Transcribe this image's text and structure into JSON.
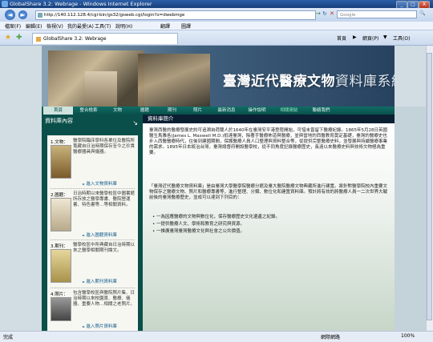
{
  "window": {
    "title": "GlobalShare 3.2: Webrage - Windows Internet Explorer",
    "minimize": "_",
    "maximize": "□",
    "close": "X"
  },
  "addressbar": {
    "url": "http://140.112.128.4/cgi-bin/gs32/gsweb.cgi/login?o=dwebmge",
    "search_placeholder": "Google",
    "back": "◄",
    "forward": "►",
    "go": "→",
    "refresh": "↻",
    "stop": "✕",
    "search_go": "🔍"
  },
  "menubar": {
    "items": [
      "檔案(F)",
      "編輯(E)",
      "檢視(V)",
      "我的最愛(A)",
      "工具(T)",
      "說明(H)"
    ],
    "toolbar_extra": [
      "翻譯",
      "圖譯"
    ]
  },
  "tabs": {
    "active": "GlobalShare 3.2: Webrage",
    "right_items": [
      "首頁",
      "▶",
      "網頁(P)",
      "▼",
      "工具(O)"
    ]
  },
  "banner": {
    "title_main": "臺灣近代醫療文物",
    "title_sub": "資料庫系統"
  },
  "nav": {
    "items": [
      "首頁",
      "整合檢索",
      "文物",
      "圖籍",
      "期刊",
      "照片",
      "最新消息",
      "操作說明",
      "相關連結",
      "聯絡我們"
    ]
  },
  "left": {
    "header": "資料庫內容",
    "items": [
      {
        "title": "1.文物：",
        "desc": "醫學院臨床學科各單位及醫院所蒐藏自日治時期保存至今之珍貴醫療器具與儀器。",
        "link": "進入文物資料庫"
      },
      {
        "title": "2.圖籍：",
        "desc": "日治時期以來醫學校區中圖書館所存放之醫學專書、醫院營運書、特色書等…等相關資料。",
        "link": "進入圖籍資料庫"
      },
      {
        "title": "3.期刊：",
        "desc": "醫學校區中所典藏自日治時期以來之醫學相關期刊論文。",
        "link": "進入期刊資料庫"
      },
      {
        "title": "4.照片：",
        "desc": "包含醫學校區與醫院照片集、日治時期以來校園景、醫療、儀器、重要人物…相關之老照片。",
        "link": "進入照片資料庫"
      }
    ]
  },
  "main": {
    "header": "資料庫簡介",
    "para1": "臺灣西醫的醫療發展史約可追溯自荷蘭人於1640年在臺灣安平港登陸開始，可惜未曾留下醫療紀錄。1865年5月28日英國醫生馬雅各(James L. Maxwell M.D.)抵達臺灣，除著手醫療佈道與醫療，並與當地的西醫教育奠定基礎，臺灣的醫療史也步入西醫醫療時代，往後到建國期間，保護醫療人員人口整理與資料整合等，從提供完整醫療史料，並發展與持續醫療事業的需求。1895年日本統治台灣，臺灣總督府開設醫學校，從不同角度記錄醫療歷史，長遠以來醫療史料與技術文物極為重要。",
    "para2": "「臺灣近代醫療文物資料庫」是由臺灣大學醫學院醫療分館及臺大醫院醫療文物典藏所進行建置。將針對醫學院校內重要文物保存之醫療文物、照片和醫療專書等，進行整理、分類、數位化和建置資料庫。預計將有效的將醫療人員一二次世界大戰前後的臺灣醫療歷史，並成可以達到下列目的：",
    "bullets": [
      "一為因應醫療的文物與數位化，保存醫療歷史文化遺產之紀錄。",
      "一提供醫療人文、學術和教育之研究與資源。",
      "一推廣臺灣臺灣醫療文化與社會之公共價值。"
    ]
  },
  "status": {
    "left": "完成",
    "zone": "網際網路",
    "zoom": "100%"
  },
  "colors": {
    "nav_bg": "#0a4f4a",
    "header_bg": "#0b1f33",
    "link": "#0b5a8a",
    "banner_title": "#ffffff"
  }
}
